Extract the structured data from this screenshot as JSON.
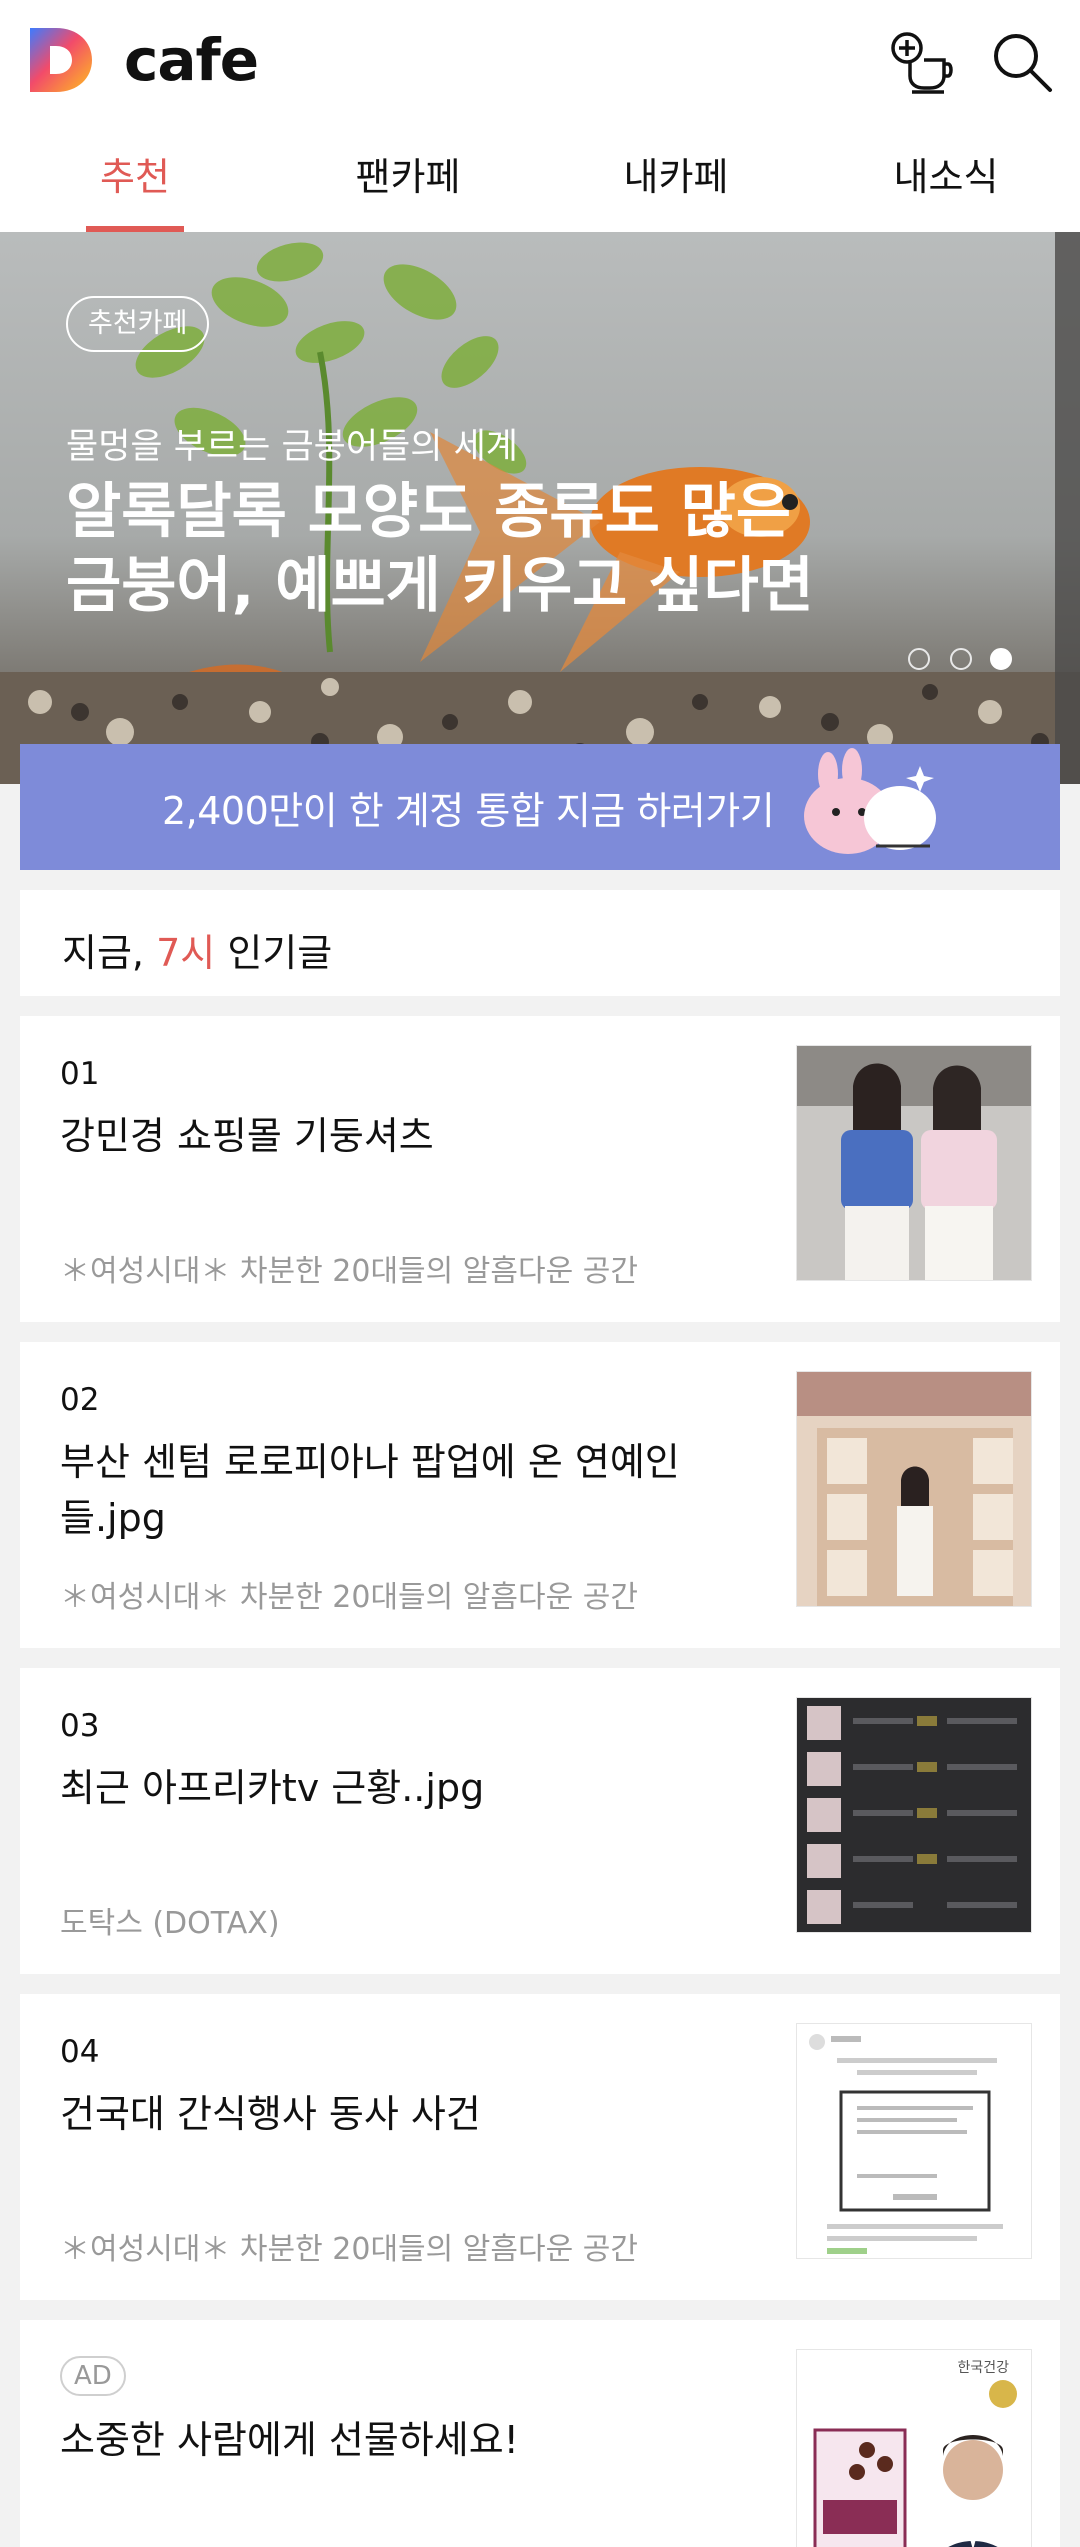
{
  "app": {
    "brand": "cafe",
    "logo_letter": "D"
  },
  "header": {
    "icons": [
      "cafe-cup-plus-icon",
      "search-icon"
    ]
  },
  "tabs": [
    {
      "label": "추천",
      "active": true
    },
    {
      "label": "팬카페",
      "active": false
    },
    {
      "label": "내카페",
      "active": false
    },
    {
      "label": "내소식",
      "active": false
    }
  ],
  "banner": {
    "chip": "추천카페",
    "subtitle": "물멍을 부르는 금붕어들의 세계",
    "title_line1": "알록달록 모양도 종류도 많은",
    "title_line2": "금붕어, 예쁘게 키우고 싶다면",
    "page_count": 3,
    "current_page": 3
  },
  "promo": {
    "text": "2,400만이 한 계정 통합 지금 하러가기"
  },
  "popular": {
    "prefix": "지금, ",
    "highlight": "7시",
    "suffix": " 인기글"
  },
  "posts": [
    {
      "rank": "01",
      "title": "강민경 쇼핑몰 기둥셔츠",
      "source": "＊여성시대＊ 차분한 20대들의 알흠다운 공간"
    },
    {
      "rank": "02",
      "title": "부산 센텀 로로피아나 팝업에 온 연예인들.jpg",
      "source": "＊여성시대＊ 차분한 20대들의 알흠다운 공간"
    },
    {
      "rank": "03",
      "title": "최근 아프리카tv 근황..jpg",
      "source": "도탁스 (DOTAX)"
    },
    {
      "rank": "04",
      "title": "건국대 간식행사 동사 사건",
      "source": "＊여성시대＊ 차분한 20대들의 알흠다운 공간"
    }
  ],
  "ad": {
    "badge": "AD",
    "title": "소중한 사람에게 선물하세요!",
    "thumb_brand": "한국건강"
  },
  "colors": {
    "accent": "#e05a55",
    "promo_bg": "#7e8bd9",
    "muted_text": "#999999"
  }
}
